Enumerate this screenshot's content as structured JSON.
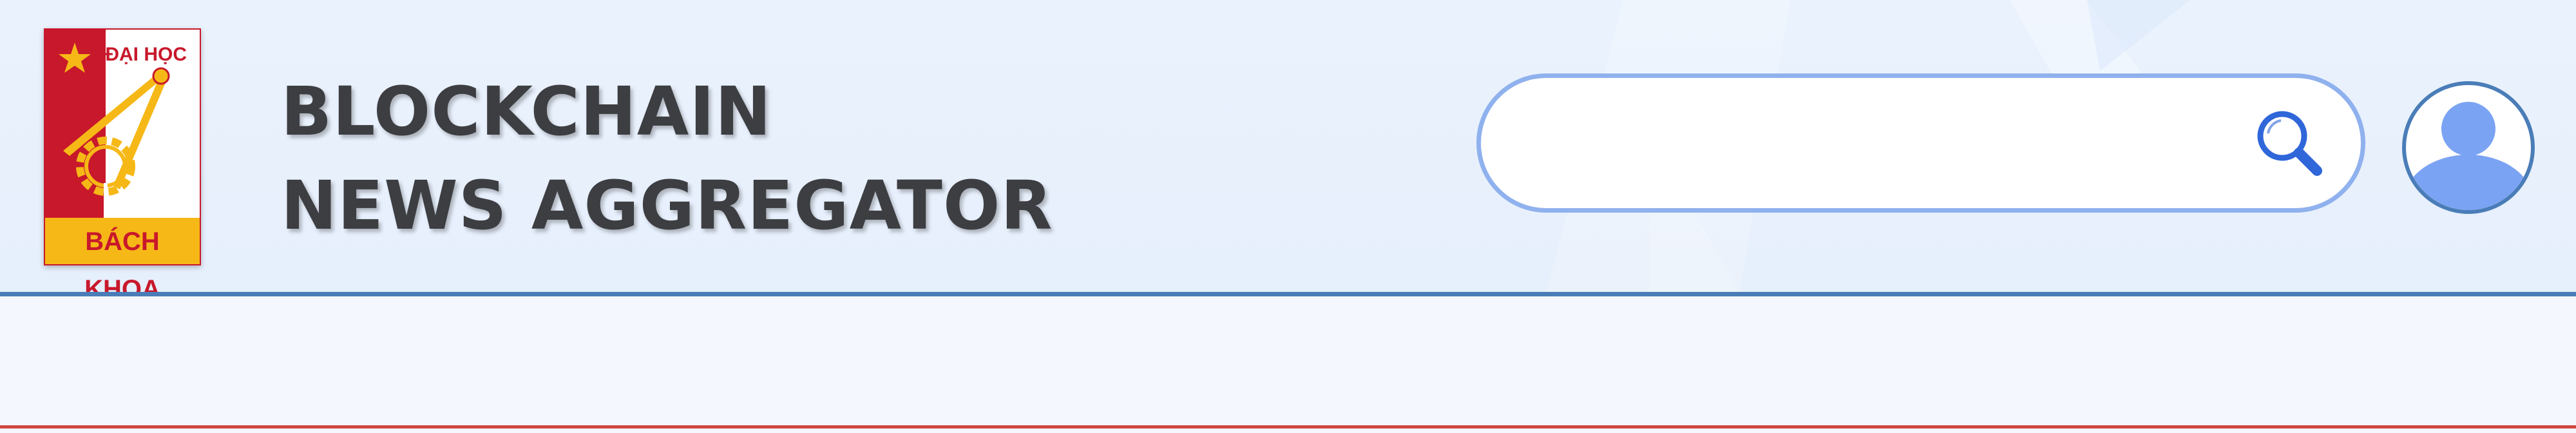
{
  "logo": {
    "top_text": "ĐẠI HỌC",
    "bottom_text": "BÁCH KHOA",
    "colors": {
      "red": "#c8182b",
      "white": "#ffffff",
      "yellow": "#f6b817"
    }
  },
  "header": {
    "title_line_1": "BLOCKCHAIN",
    "title_line_2": "NEWS AGGREGATOR"
  },
  "search": {
    "value": "",
    "placeholder": "",
    "icon": "search-icon"
  },
  "user": {
    "icon": "user-avatar-icon"
  },
  "colors": {
    "header_bg": "#e8f1fd",
    "title_text": "#3d3e42",
    "accent_blue": "#4a7db8",
    "search_border": "#8fb1ee",
    "avatar_fill": "#7ba3f3",
    "bottom_accent": "#d2463f"
  }
}
